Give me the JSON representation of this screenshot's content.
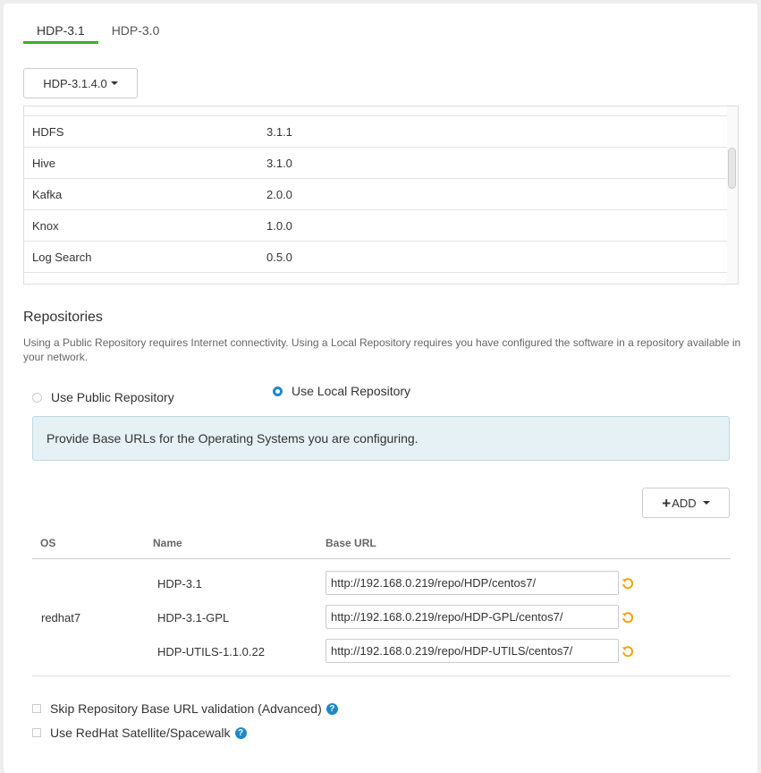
{
  "stack_tabs": [
    "HDP-3.1",
    "HDP-3.0"
  ],
  "version_selector": {
    "label": "HDP-3.1.4.0"
  },
  "services": [
    {
      "name": "HDFS",
      "version": "3.1.1"
    },
    {
      "name": "Hive",
      "version": "3.1.0"
    },
    {
      "name": "Kafka",
      "version": "2.0.0"
    },
    {
      "name": "Knox",
      "version": "1.0.0"
    },
    {
      "name": "Log Search",
      "version": "0.5.0"
    }
  ],
  "repositories": {
    "title": "Repositories",
    "description": "Using a Public Repository requires Internet connectivity. Using a Local Repository requires you have configured the software in a repository available in your network.",
    "public_option": "Use Public Repository",
    "local_option": "Use Local Repository",
    "selected": "local",
    "info": "Provide Base URLs for the Operating Systems you are configuring.",
    "add_label": "ADD",
    "columns": {
      "os": "OS",
      "name": "Name",
      "base_url": "Base URL"
    },
    "os": "redhat7",
    "repos": [
      {
        "name": "HDP-3.1",
        "url": "http://192.168.0.219/repo/HDP/centos7/"
      },
      {
        "name": "HDP-3.1-GPL",
        "url": "http://192.168.0.219/repo/HDP-GPL/centos7/"
      },
      {
        "name": "HDP-UTILS-1.1.0.22",
        "url": "http://192.168.0.219/repo/HDP-UTILS/centos7/"
      }
    ],
    "skip_validation": "Skip Repository Base URL validation (Advanced)",
    "satellite": "Use RedHat Satellite/Spacewalk"
  },
  "colors": {
    "accent_green": "#3fae2a",
    "accent_blue": "#1e88c8",
    "undo_orange": "#f0a30a",
    "info_bg": "#e6f1f5"
  }
}
